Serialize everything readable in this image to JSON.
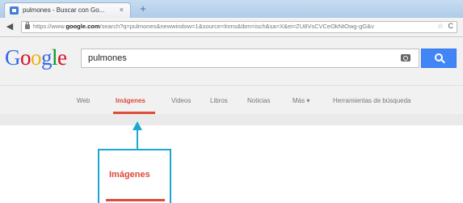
{
  "browser": {
    "tab_title": "pulmones - Buscar con Go...",
    "tab_close": "×",
    "new_tab": "+",
    "back": "◀",
    "url_prefix": "https://www.",
    "url_domain": "google.com",
    "url_rest": "/search?q=pulmones&newwindow=1&source=lnms&tbm=isch&sa=X&ei=ZU8VsCVCeOkNtOwg-gG&v",
    "url_star": "☆",
    "url_reload": "C"
  },
  "google": {
    "logo_letters": [
      "G",
      "o",
      "o",
      "g",
      "l",
      "e"
    ],
    "search_value": "pulmones"
  },
  "nav": {
    "items": [
      {
        "label": "Web"
      },
      {
        "label": "Imágenes"
      },
      {
        "label": "Videos"
      },
      {
        "label": "Libros"
      },
      {
        "label": "Noticias"
      },
      {
        "label": "Más ▾"
      },
      {
        "label": "Herramientas de búsqueda"
      }
    ],
    "active_index": 1
  },
  "callout": {
    "label": "Imágenes"
  },
  "colors": {
    "active_red": "#dd4b39",
    "callout_blue": "#1aa7d1",
    "search_blue": "#4285f4"
  },
  "icons": [
    "favicon-icon",
    "lock-icon",
    "star-icon",
    "reload-icon",
    "camera-icon",
    "magnifier-icon",
    "arrow-up-icon"
  ]
}
